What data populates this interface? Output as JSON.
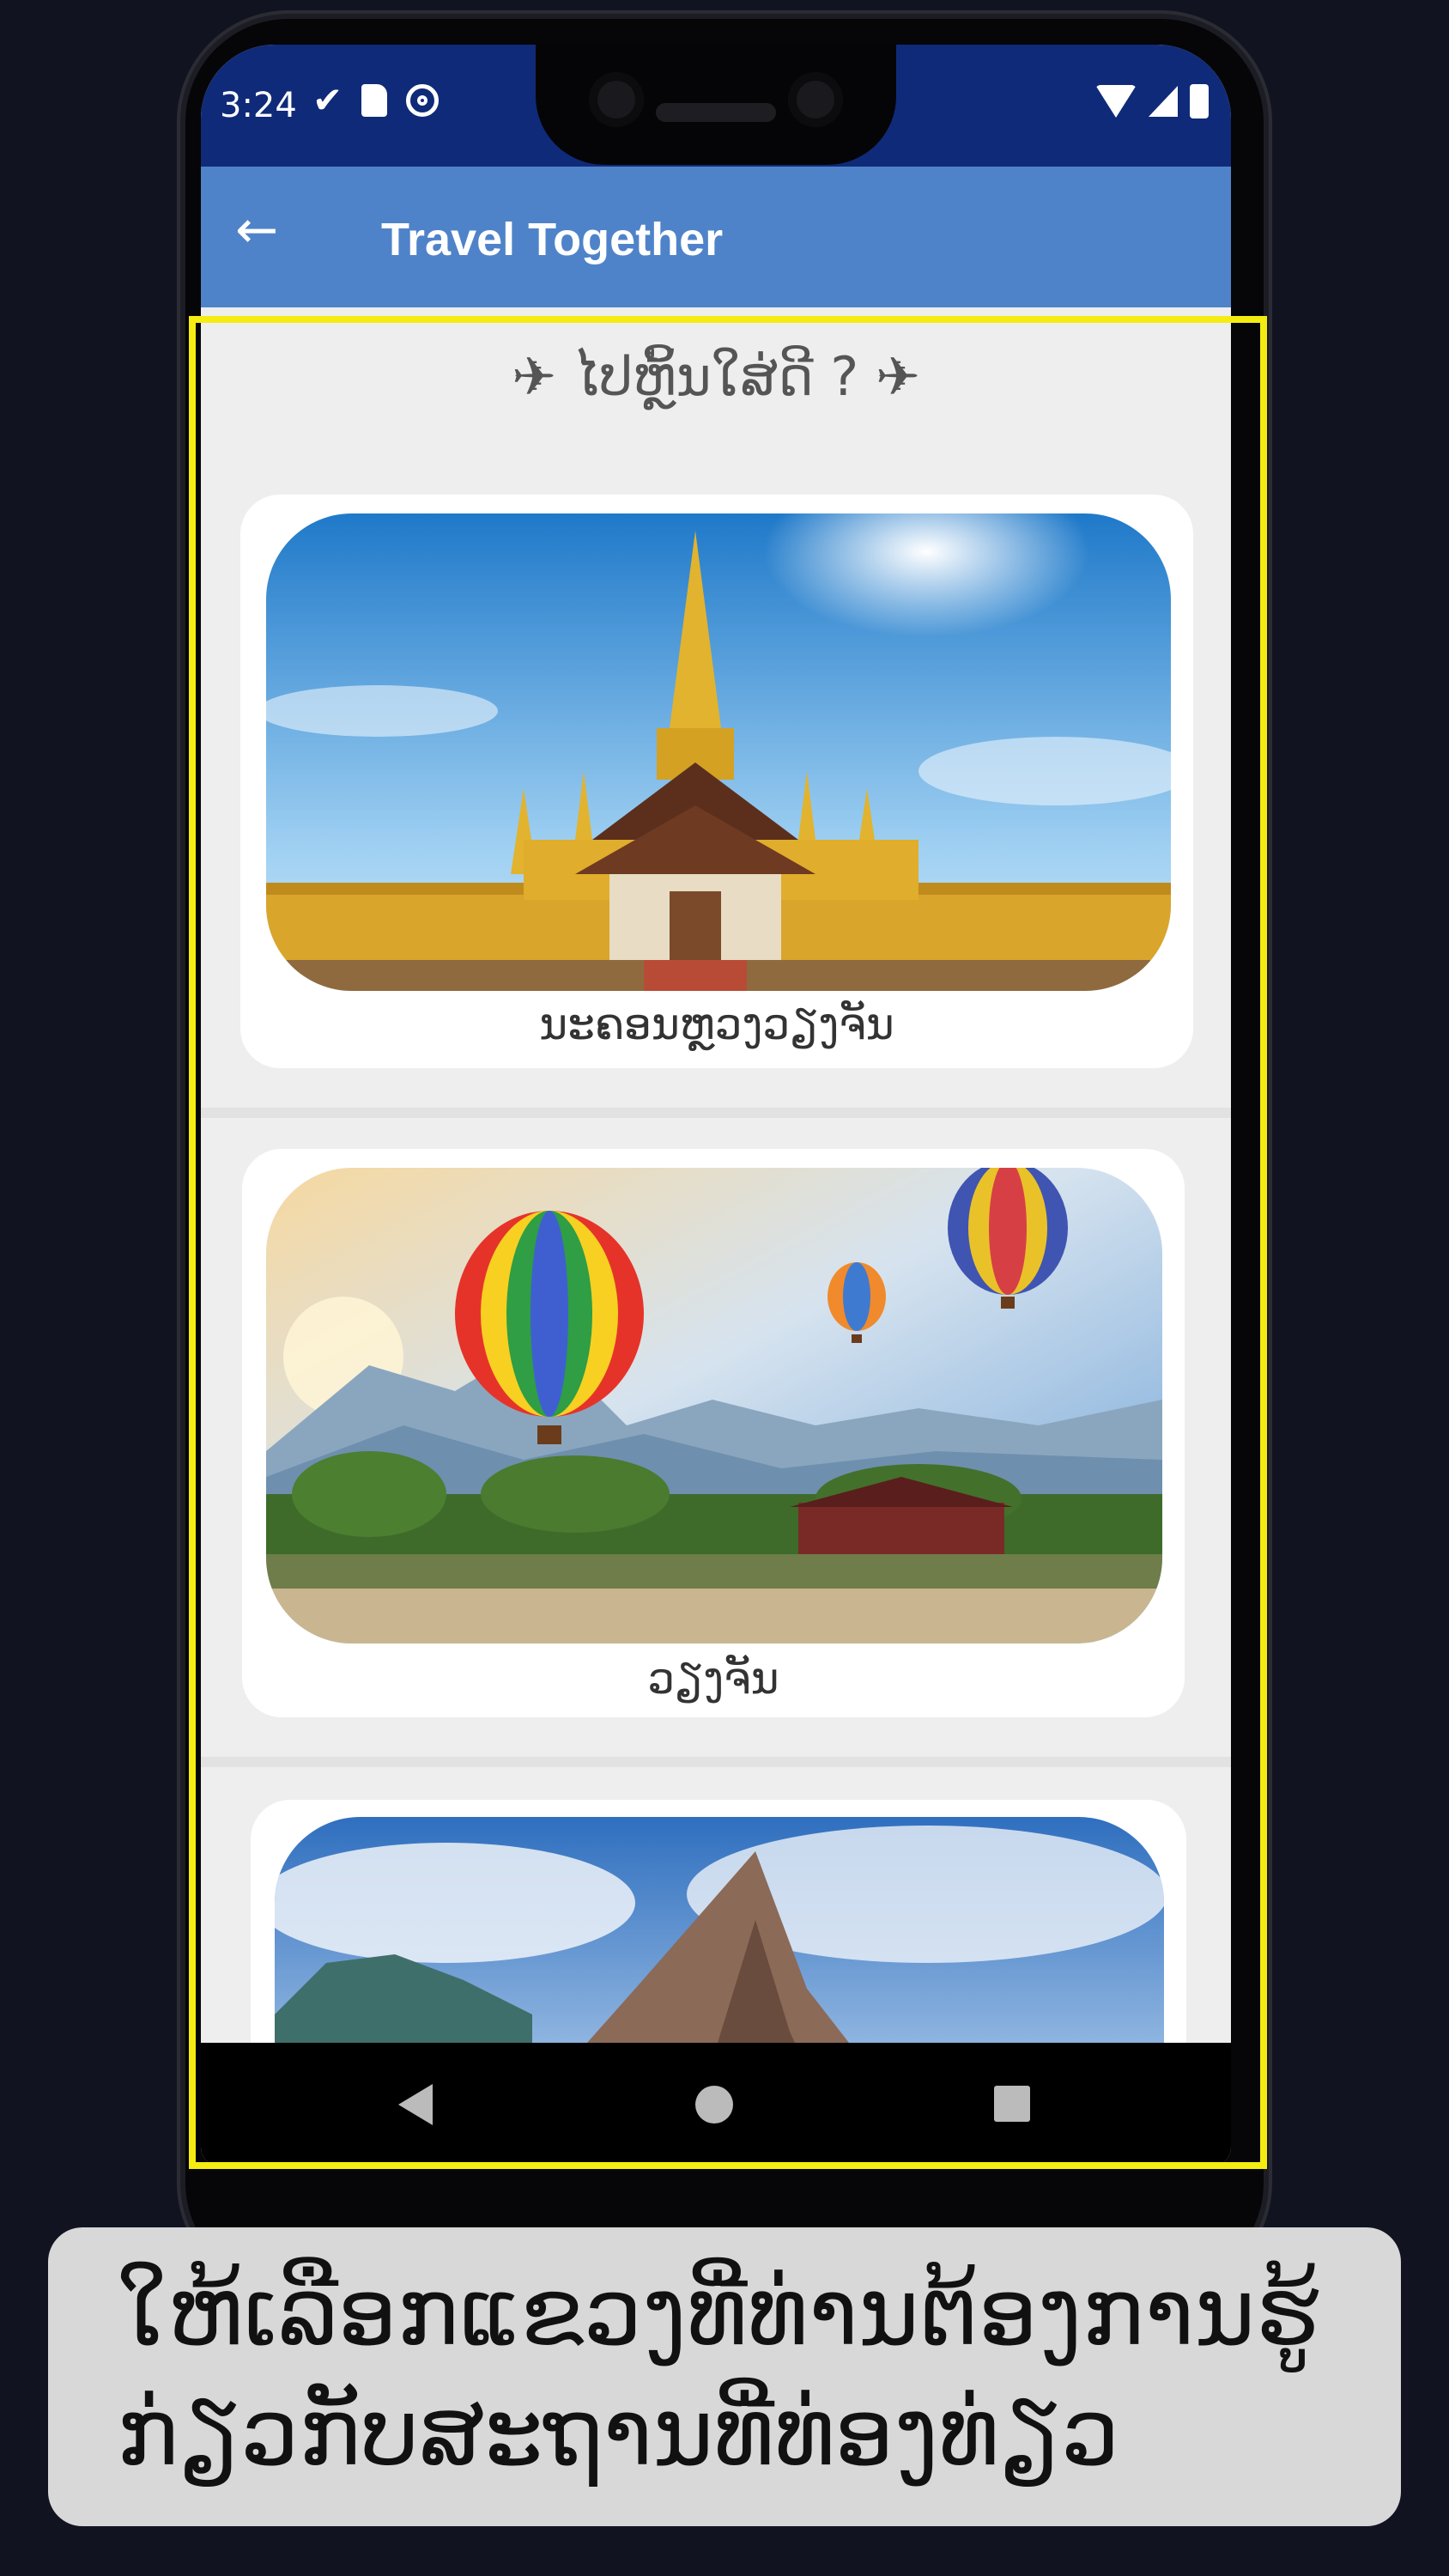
{
  "status_bar": {
    "time": "3:24",
    "left_icons": [
      "check-icon",
      "sd-card-icon",
      "sync-icon"
    ],
    "right_icons": [
      "wifi-icon",
      "signal-icon",
      "battery-icon"
    ]
  },
  "app_bar": {
    "title": "Travel Together",
    "back_icon": "←"
  },
  "content": {
    "heading": "✈ ໄປຫຼິ້ນໃສ່ດີ ? ✈",
    "cards": [
      {
        "caption": "ນະຄອນຫຼວງວຽງຈັນ",
        "image": "that-luang-stupa"
      },
      {
        "caption": "ວຽງຈັນ",
        "image": "hot-air-balloons-vang-vieng"
      },
      {
        "caption": "",
        "image": "wat-phou-temple"
      }
    ]
  },
  "nav_bar": {
    "buttons": [
      "back",
      "home",
      "recents"
    ]
  },
  "instruction": {
    "line1": "ໃຫ້ເລືອກແຂວງທີ່ທ່ານຕ້ອງການຮູ້",
    "line2": "ກ່ຽວກັບສະຖານທີ່ທ່ອງທ່ຽວ"
  },
  "colors": {
    "status_bar": "#0f2a78",
    "app_bar": "#4f83c9",
    "highlight": "#f5ec12",
    "background": "#111321"
  }
}
